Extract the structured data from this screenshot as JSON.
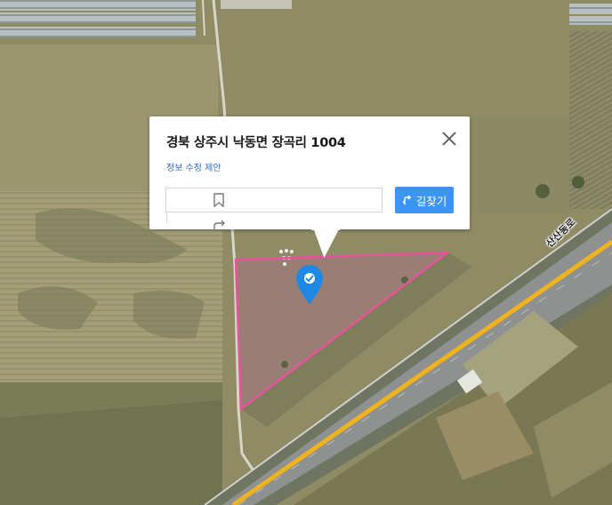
{
  "map": {
    "type": "satellite",
    "road_label": "산산동로"
  },
  "popup": {
    "address": "경북 상주시 낙동면 장곡리 1004",
    "edit_link": "정보 수정 제안",
    "route_button": "길찾기"
  },
  "icons": {
    "close": "close-icon",
    "bookmark": "bookmark-icon",
    "share": "share-icon",
    "route": "route-icon",
    "marker": "location-pin-icon"
  },
  "colors": {
    "parcel_outline": "#e8539c",
    "marker": "#1e88e5",
    "route_button": "#3c95f4",
    "highway_line": "#f0b21d"
  }
}
